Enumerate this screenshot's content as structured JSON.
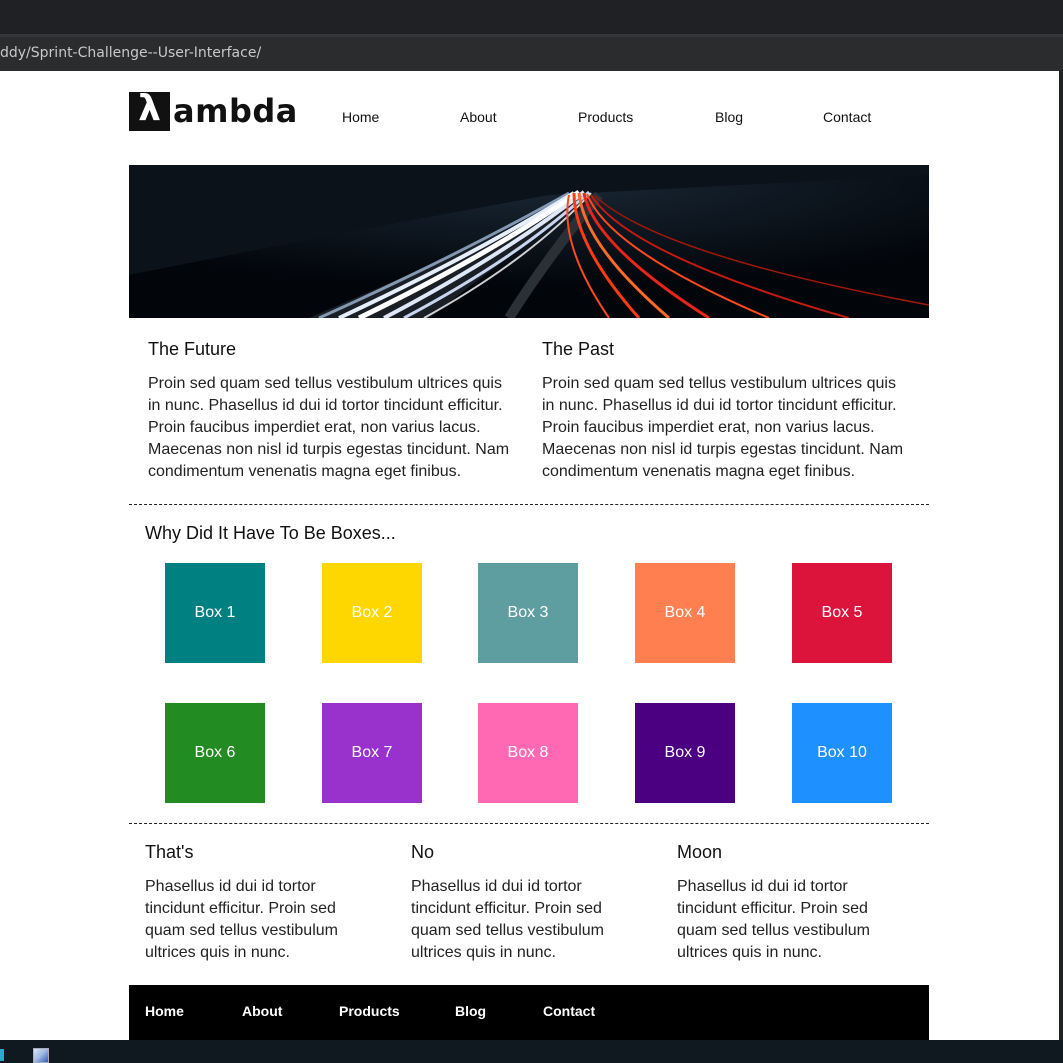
{
  "browser": {
    "address": "ddy/Sprint-Challenge--User-Interface/"
  },
  "logo": {
    "glyph": "λ",
    "text": "ambda"
  },
  "nav": [
    "Home",
    "About",
    "Products",
    "Blog",
    "Contact"
  ],
  "top_content": [
    {
      "title": "The Future",
      "text": "Proin sed quam sed tellus vestibulum ultrices quis in nunc. Phasellus id dui id tortor tincidunt efficitur. Proin faucibus imperdiet erat, non varius lacus. Maecenas non nisl id turpis egestas tincidunt. Nam condimentum venenatis magna eget finibus."
    },
    {
      "title": "The Past",
      "text": "Proin sed quam sed tellus vestibulum ultrices quis in nunc. Phasellus id dui id tortor tincidunt efficitur. Proin faucibus imperdiet erat, non varius lacus. Maecenas non nisl id turpis egestas tincidunt. Nam condimentum venenatis magna eget finibus."
    }
  ],
  "boxes_section": {
    "title": "Why Did It Have To Be Boxes...",
    "boxes": [
      {
        "label": "Box 1",
        "color": "#008080"
      },
      {
        "label": "Box 2",
        "color": "#ffd700"
      },
      {
        "label": "Box 3",
        "color": "#5f9ea0"
      },
      {
        "label": "Box 4",
        "color": "#ff7f50"
      },
      {
        "label": "Box 5",
        "color": "#dc143c"
      },
      {
        "label": "Box 6",
        "color": "#228b22"
      },
      {
        "label": "Box 7",
        "color": "#9932cc"
      },
      {
        "label": "Box 8",
        "color": "#ff69b4"
      },
      {
        "label": "Box 9",
        "color": "#4b0082"
      },
      {
        "label": "Box 10",
        "color": "#1e90ff"
      }
    ]
  },
  "bottom_content": [
    {
      "title": "That's",
      "text": "Phasellus id dui id tortor tincidunt efficitur. Proin sed quam sed tellus vestibulum ultrices quis in nunc."
    },
    {
      "title": "No",
      "text": "Phasellus id dui id tortor tincidunt efficitur. Proin sed quam sed tellus vestibulum ultrices quis in nunc."
    },
    {
      "title": "Moon",
      "text": "Phasellus id dui id tortor tincidunt efficitur. Proin sed quam sed tellus vestibulum ultrices quis in nunc."
    }
  ],
  "footer_nav": [
    "Home",
    "About",
    "Products",
    "Blog",
    "Contact"
  ]
}
